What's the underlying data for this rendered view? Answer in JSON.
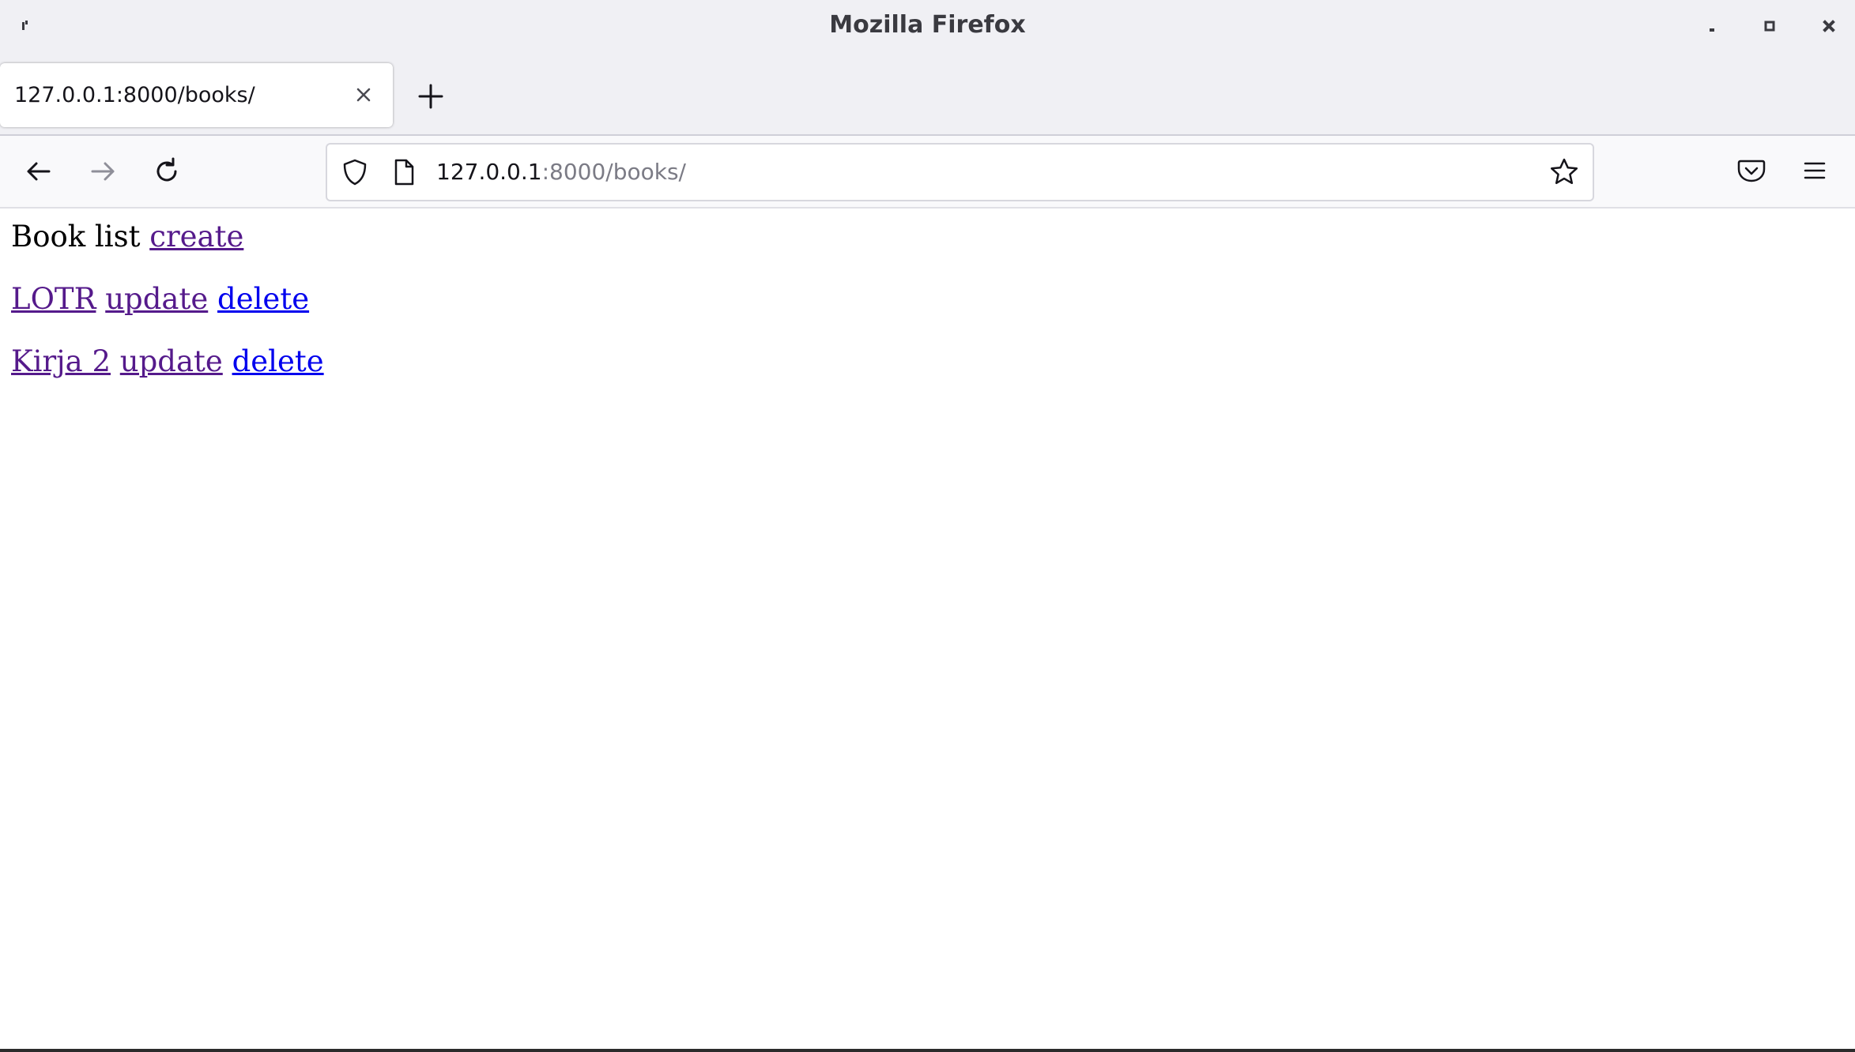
{
  "window": {
    "title": "Mozilla Firefox"
  },
  "tabs": [
    {
      "title": "127.0.0.1:8000/books/",
      "active": true
    }
  ],
  "urlbar": {
    "host": "127.0.0.1",
    "path": ":8000/books/"
  },
  "icons": {
    "back": "back-arrow-icon",
    "forward": "forward-arrow-icon",
    "reload": "reload-icon",
    "shield": "shield-icon",
    "page": "page-icon",
    "bookmark": "star-icon",
    "pocket": "pocket-icon",
    "menu": "hamburger-menu-icon"
  },
  "page": {
    "heading": "Book list",
    "create_link": "create",
    "books": [
      {
        "title": "LOTR",
        "update": "update",
        "delete": "delete"
      },
      {
        "title": "Kirja 2",
        "update": "update",
        "delete": "delete"
      }
    ]
  },
  "colors": {
    "visited_link": "#551a8b",
    "unvisited_link": "#0000ee",
    "chrome_bg": "#f0f0f4"
  }
}
